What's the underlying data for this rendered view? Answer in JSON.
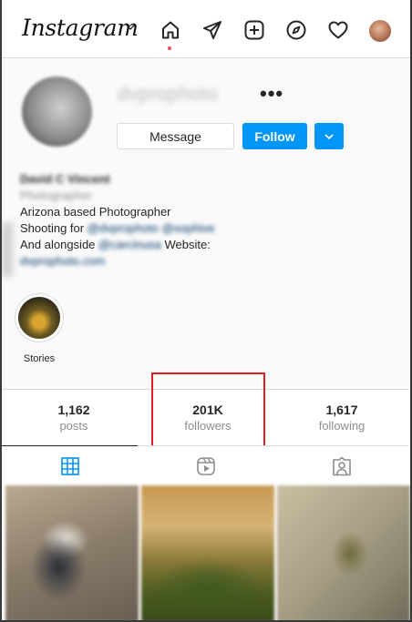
{
  "nav": {
    "logo_text": "Instagram",
    "icons": [
      "chevron-down-icon",
      "home-icon",
      "direct-icon",
      "new-post-icon",
      "explore-icon",
      "activity-icon"
    ],
    "notification_dot_color": "#ed4956"
  },
  "profile": {
    "username": "dvprophoto",
    "more_symbol": "•••",
    "message_label": "Message",
    "follow_label": "Follow",
    "follow_color": "#0095f6",
    "bio": {
      "name": "David C Vincent",
      "category": "Photographer",
      "line1": "Arizona based Photographer",
      "line2_prefix": "Shooting for ",
      "line2_link1": "@dvprophoto",
      "line2_link2": "@sophive",
      "line3_prefix": "And alongside ",
      "line3_link": "@carcinusa",
      "line3_suffix": " Website:",
      "website": "dvprophoto.com"
    },
    "story_label": "Stories"
  },
  "stats": {
    "posts": {
      "count": "1,162",
      "label": "posts"
    },
    "followers": {
      "count": "201K",
      "label": "followers"
    },
    "following": {
      "count": "1,617",
      "label": "following"
    }
  },
  "highlight_color": "#e01b24",
  "tabs": [
    "grid-icon",
    "reels-icon",
    "tagged-icon"
  ]
}
